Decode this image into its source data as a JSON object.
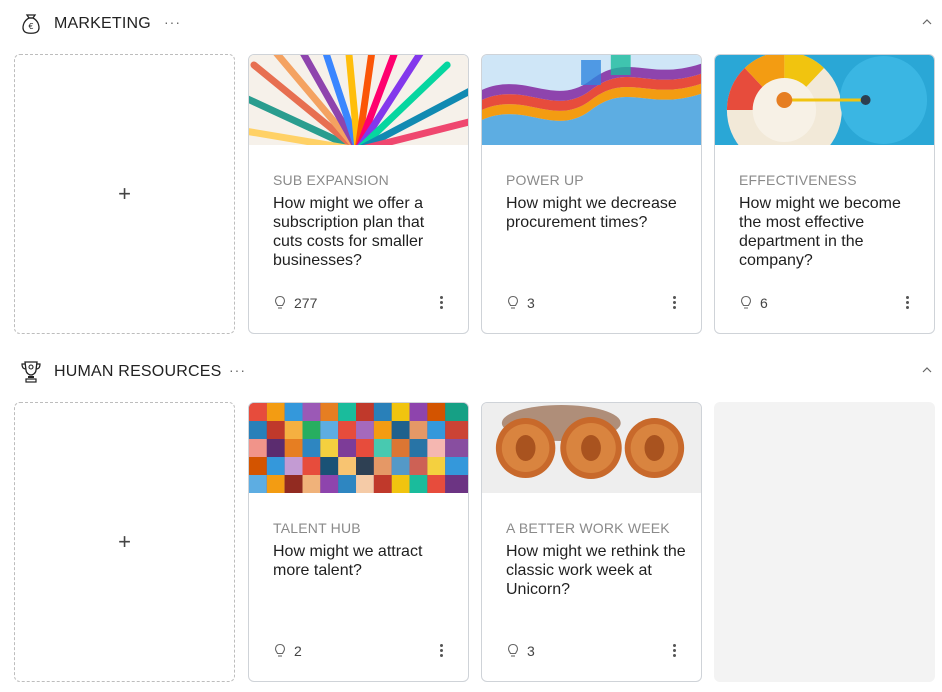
{
  "sections": [
    {
      "title": "MARKETING",
      "more_label": "···",
      "icon": "money-bag-icon",
      "add_label": "+",
      "cards": [
        {
          "tag": "SUB EXPANSION",
          "question": "How might we offer a subscription plan that cuts costs for smaller businesses?",
          "count": "277",
          "image": "colorful-fan-image"
        },
        {
          "tag": "POWER UP",
          "question": "How might we decrease procurement times?",
          "count": "3",
          "image": "colorful-waves-image"
        },
        {
          "tag": "EFFECTIVENESS",
          "question": "How might we become the most effective department in the company?",
          "count": "6",
          "image": "gauge-dial-image"
        }
      ]
    },
    {
      "title": "HUMAN RESOURCES",
      "more_label": "···",
      "icon": "trophy-people-icon",
      "add_label": "+",
      "cards": [
        {
          "tag": "TALENT HUB",
          "question": "How might we attract more talent?",
          "count": "2",
          "image": "portrait-mosaic-image"
        },
        {
          "tag": "A BETTER WORK WEEK",
          "question": "How might we rethink the classic work week at Unicorn?",
          "count": "3",
          "image": "copper-coins-image"
        }
      ]
    }
  ]
}
